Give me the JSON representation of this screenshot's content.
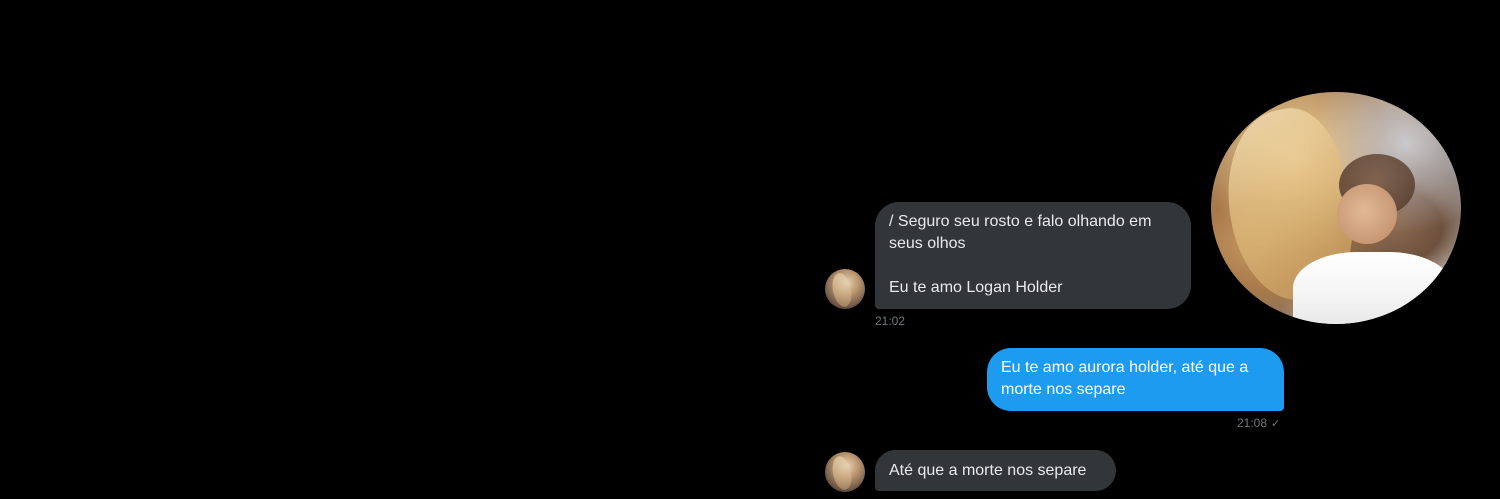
{
  "conversation": {
    "messages": [
      {
        "direction": "received",
        "lines": [
          "/ Seguro seu rosto e falo olhando em",
          "seus olhos",
          "",
          "Eu te amo Logan Holder"
        ],
        "time": "21:02"
      },
      {
        "direction": "sent",
        "lines": [
          "Eu te amo aurora holder, até que a",
          "morte nos separe"
        ],
        "time": "21:08",
        "status_icon": "check-icon",
        "status_glyph": "✓"
      },
      {
        "direction": "received",
        "lines": [
          "Até que a morte nos separe"
        ],
        "time": ""
      }
    ]
  },
  "colors": {
    "background": "#000000",
    "received_bubble": "#333639",
    "sent_bubble": "#1d9bf0",
    "timestamp": "#71767b"
  }
}
